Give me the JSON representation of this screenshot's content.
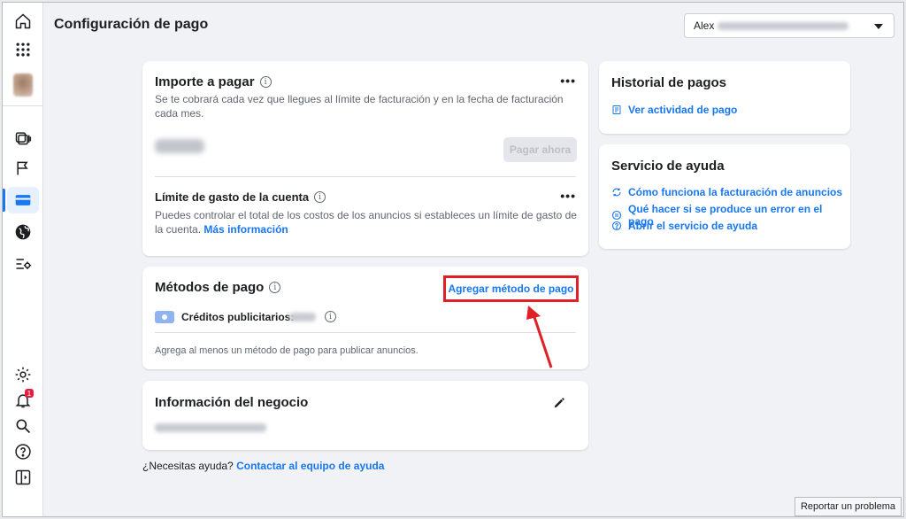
{
  "header": {
    "title": "Configuración de pago",
    "account_name": "Alex"
  },
  "sidebar": {
    "items": [
      {
        "name": "home-icon"
      },
      {
        "name": "apps-grid-icon"
      },
      {
        "name": "avatar"
      },
      {
        "name": "ads-manager-icon"
      },
      {
        "name": "flag-icon"
      },
      {
        "name": "credit-card-icon"
      },
      {
        "name": "globe-icon"
      },
      {
        "name": "settings-list-icon"
      }
    ],
    "bottom_items": [
      {
        "name": "gear-icon"
      },
      {
        "name": "bell-icon"
      },
      {
        "name": "search-icon"
      },
      {
        "name": "help-icon"
      },
      {
        "name": "sidebar-toggle-icon"
      }
    ],
    "notification_count": "1"
  },
  "amount_due": {
    "title": "Importe a pagar",
    "description": "Se te cobrará cada vez que llegues al límite de facturación y en la fecha de facturación cada mes.",
    "pay_button": "Pagar ahora",
    "spend_limit_title": "Límite de gasto de la cuenta",
    "spend_limit_description": "Puedes controlar el total de los costos de los anuncios si estableces un límite de gasto de la cuenta.",
    "more_info_link": "Más información"
  },
  "payment_methods": {
    "title": "Métodos de pago",
    "add_link": "Agregar método de pago",
    "credits_label": "Créditos publicitarios:",
    "hint": "Agrega al menos un método de pago para publicar anuncios."
  },
  "business_info": {
    "title": "Información del negocio"
  },
  "payment_history": {
    "title": "Historial de pagos",
    "link": "Ver actividad de pago"
  },
  "help_center": {
    "title": "Servicio de ayuda",
    "links": [
      "Cómo funciona la facturación de anuncios",
      "Qué hacer si se produce un error en el pago",
      "Abrir el servicio de ayuda"
    ]
  },
  "footer": {
    "question": "¿Necesitas ayuda?",
    "contact_link": "Contactar al equipo de ayuda",
    "report_button": "Reportar un problema"
  },
  "colors": {
    "accent": "#1877f2",
    "highlight": "#e01f26",
    "background": "#f0f2f5"
  }
}
